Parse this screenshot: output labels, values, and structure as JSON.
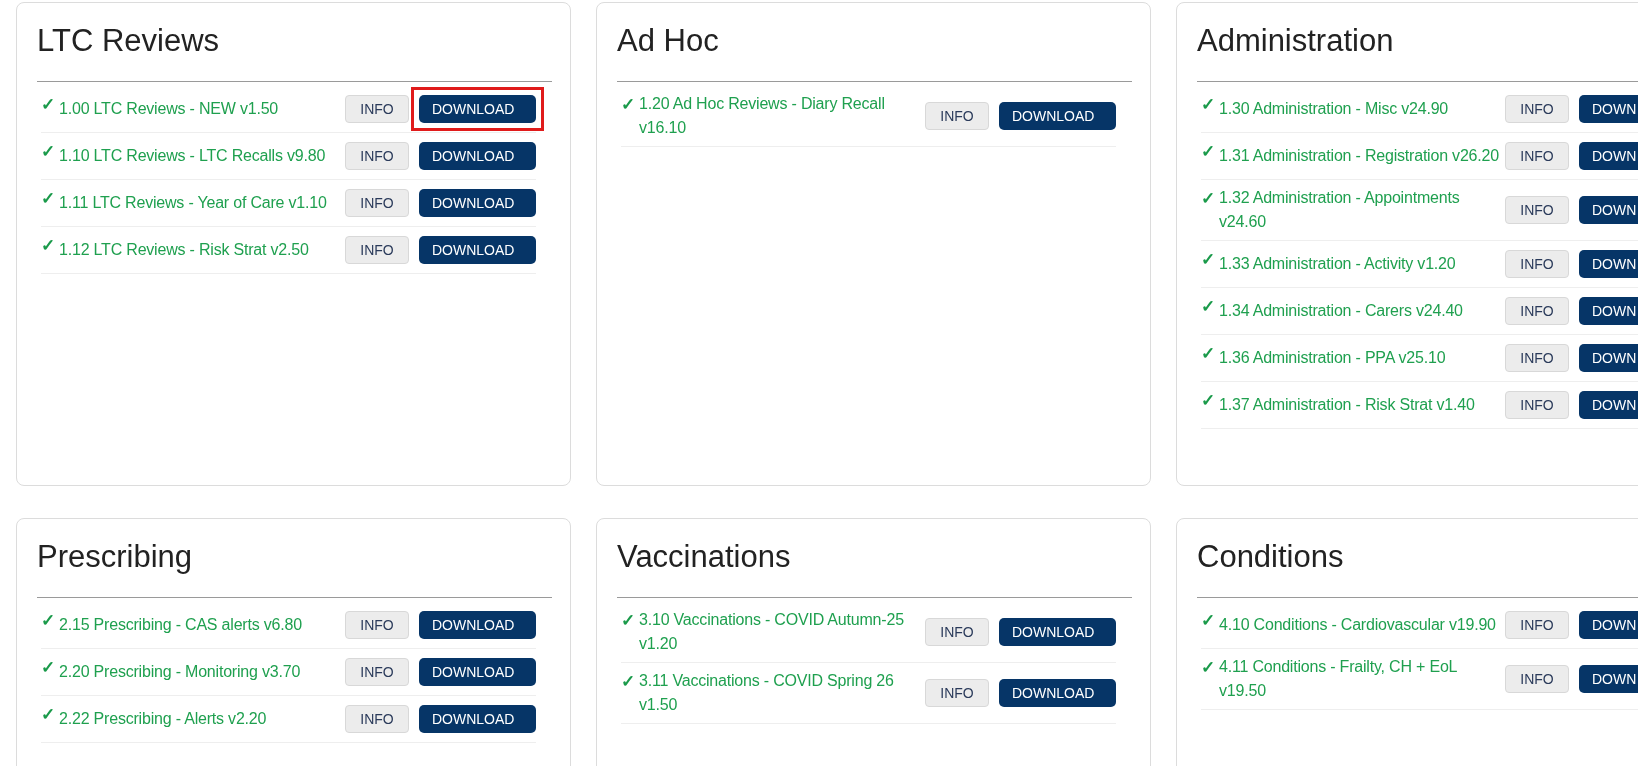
{
  "cards": [
    {
      "title": "LTC Reviews",
      "items": [
        {
          "check": "✓",
          "label": "1.00 LTC Reviews - NEW v1.50",
          "info": "INFO",
          "download": "DOWNLOAD",
          "highlighted": true
        },
        {
          "check": "✓",
          "label": "1.10 LTC Reviews - LTC Recalls v9.80",
          "info": "INFO",
          "download": "DOWNLOAD",
          "highlighted": false
        },
        {
          "check": "✓",
          "label": "1.11 LTC Reviews - Year of Care v1.10",
          "info": "INFO",
          "download": "DOWNLOAD",
          "highlighted": false
        },
        {
          "check": "✓",
          "label": "1.12 LTC Reviews - Risk Strat v2.50",
          "info": "INFO",
          "download": "DOWNLOAD",
          "highlighted": false
        }
      ]
    },
    {
      "title": "Ad Hoc",
      "items": [
        {
          "check": "✓",
          "label": "1.20 Ad Hoc Reviews - Diary Recall v16.10",
          "info": "INFO",
          "download": "DOWNLOAD",
          "highlighted": false
        }
      ]
    },
    {
      "title": "Administration",
      "items": [
        {
          "check": "✓",
          "label": "1.30 Administration - Misc v24.90",
          "info": "INFO",
          "download": "DOWN",
          "highlighted": false
        },
        {
          "check": "✓",
          "label": "1.31 Administration - Registration v26.20",
          "info": "INFO",
          "download": "DOWN",
          "highlighted": false
        },
        {
          "check": "✓",
          "label": "1.32 Administration - Appointments v24.60",
          "info": "INFO",
          "download": "DOWN",
          "highlighted": false
        },
        {
          "check": "✓",
          "label": "1.33 Administration - Activity v1.20",
          "info": "INFO",
          "download": "DOWN",
          "highlighted": false
        },
        {
          "check": "✓",
          "label": "1.34 Administration - Carers v24.40",
          "info": "INFO",
          "download": "DOWN",
          "highlighted": false
        },
        {
          "check": "✓",
          "label": "1.36 Administration - PPA v25.10",
          "info": "INFO",
          "download": "DOWN",
          "highlighted": false
        },
        {
          "check": "✓",
          "label": "1.37 Administration - Risk Strat v1.40",
          "info": "INFO",
          "download": "DOWN",
          "highlighted": false
        }
      ]
    },
    {
      "title": "Prescribing",
      "items": [
        {
          "check": "✓",
          "label": "2.15 Prescribing - CAS alerts v6.80",
          "info": "INFO",
          "download": "DOWNLOAD",
          "highlighted": false
        },
        {
          "check": "✓",
          "label": "2.20 Prescribing - Monitoring v3.70",
          "info": "INFO",
          "download": "DOWNLOAD",
          "highlighted": false
        },
        {
          "check": "✓",
          "label": "2.22 Prescribing - Alerts v2.20",
          "info": "INFO",
          "download": "DOWNLOAD",
          "highlighted": false
        }
      ]
    },
    {
      "title": "Vaccinations",
      "items": [
        {
          "check": "✓",
          "label": "3.10 Vaccinations - COVID Autumn-25 v1.20",
          "info": "INFO",
          "download": "DOWNLOAD",
          "highlighted": false
        },
        {
          "check": "✓",
          "label": "3.11 Vaccinations - COVID Spring 26 v1.50",
          "info": "INFO",
          "download": "DOWNLOAD",
          "highlighted": false
        }
      ]
    },
    {
      "title": "Conditions",
      "items": [
        {
          "check": "✓",
          "label": "4.10 Conditions - Cardiovascular v19.90",
          "info": "INFO",
          "download": "DOWN",
          "highlighted": false
        },
        {
          "check": "✓",
          "label": "4.11 Conditions - Frailty, CH + EoL v19.50",
          "info": "INFO",
          "download": "DOWN",
          "highlighted": false
        }
      ]
    }
  ]
}
